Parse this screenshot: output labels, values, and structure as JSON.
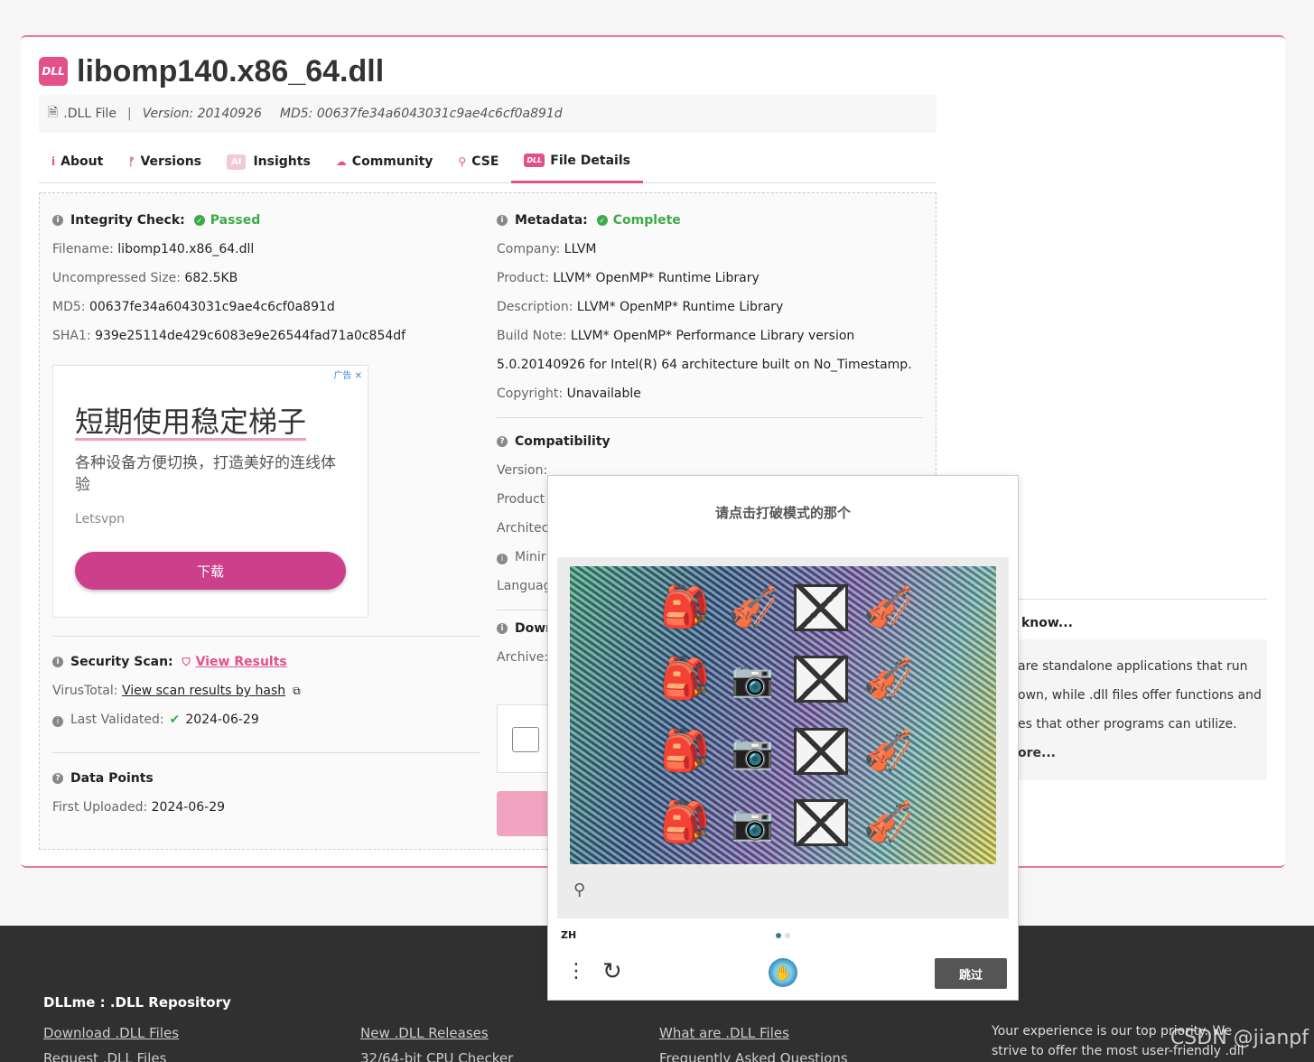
{
  "header": {
    "badge": "DLL",
    "title": "libomp140.x86_64.dll",
    "file_type": ".DLL File",
    "separator": "|",
    "version": "Version: 20140926",
    "md5": "MD5: 00637fe34a6043031c9ae4c6cf0a891d"
  },
  "tabs": [
    {
      "icon": "i",
      "label": "About"
    },
    {
      "icon": "ᚠ",
      "label": "Versions"
    },
    {
      "icon": "AI",
      "label": "Insights"
    },
    {
      "icon": "☁",
      "label": "Community"
    },
    {
      "icon": "⚲",
      "label": "CSE"
    },
    {
      "icon": "DLL",
      "label": "File Details"
    }
  ],
  "integrity": {
    "heading": "Integrity Check:",
    "status": "Passed",
    "rows": [
      {
        "k": "Filename: ",
        "v": "libomp140.x86_64.dll"
      },
      {
        "k": "Uncompressed Size: ",
        "v": "682.5KB"
      },
      {
        "k": "MD5: ",
        "v": "00637fe34a6043031c9ae4c6cf0a891d"
      },
      {
        "k": "SHA1: ",
        "v": "939e25114de429c6083e9e26544fad71a0c854df"
      }
    ]
  },
  "ad": {
    "tag": "广告 ✕",
    "headline": "短期使用稳定梯子",
    "body": "各种设备方便切换，打造美好的连线体验",
    "brand": "Letsvpn",
    "button": "下载"
  },
  "security": {
    "heading": "Security Scan:",
    "link": "View Results",
    "vt_label": "VirusTotal: ",
    "vt_link": "View scan results by hash",
    "validated_label": "Last Validated:",
    "validated_date": "2024-06-29"
  },
  "data_points": {
    "heading": "Data Points",
    "first_uploaded": "First Uploaded: ",
    "date": "2024-06-29"
  },
  "metadata": {
    "heading": "Metadata:",
    "status": "Complete",
    "rows": [
      {
        "k": "Company: ",
        "v": "LLVM"
      },
      {
        "k": "Product: ",
        "v": "LLVM* OpenMP* Runtime Library"
      },
      {
        "k": "Description: ",
        "v": "LLVM* OpenMP* Runtime Library"
      },
      {
        "k": "Build Note: ",
        "v": "LLVM* OpenMP* Performance Library version"
      },
      {
        "k": "",
        "v": "5.0.20140926 for Intel(R) 64 architecture built on No_Timestamp."
      },
      {
        "k": "Copyright: ",
        "v": "Unavailable"
      }
    ]
  },
  "compat": {
    "heading": "Compatibility",
    "rows": [
      "Version: ",
      "Product",
      "Architect",
      "Minir",
      "Languag"
    ]
  },
  "download": {
    "heading": "Dowr",
    "archive": "Archive:"
  },
  "aside": {
    "heading": "know...",
    "lines": [
      "are standalone applications that run",
      "own, while .dll files offer functions and",
      "es that other programs can utilize.",
      "ore..."
    ]
  },
  "captcha": {
    "prompt": "请点击打破模式的那个",
    "lang": "ZH",
    "skip": "跳过"
  },
  "footer": {
    "title": "DLLme : .DLL Repository",
    "links": [
      "Download .DLL Files",
      "Request .DLL Files",
      "New .DLL Releases",
      "32/64-bit CPU Checker",
      "What are .DLL Files",
      "Frequently Asked Questions"
    ],
    "note": "Your experience is our top priority. We strive to offer the most user-friendly .dll",
    "watermark": "CSDN @jianpf"
  }
}
